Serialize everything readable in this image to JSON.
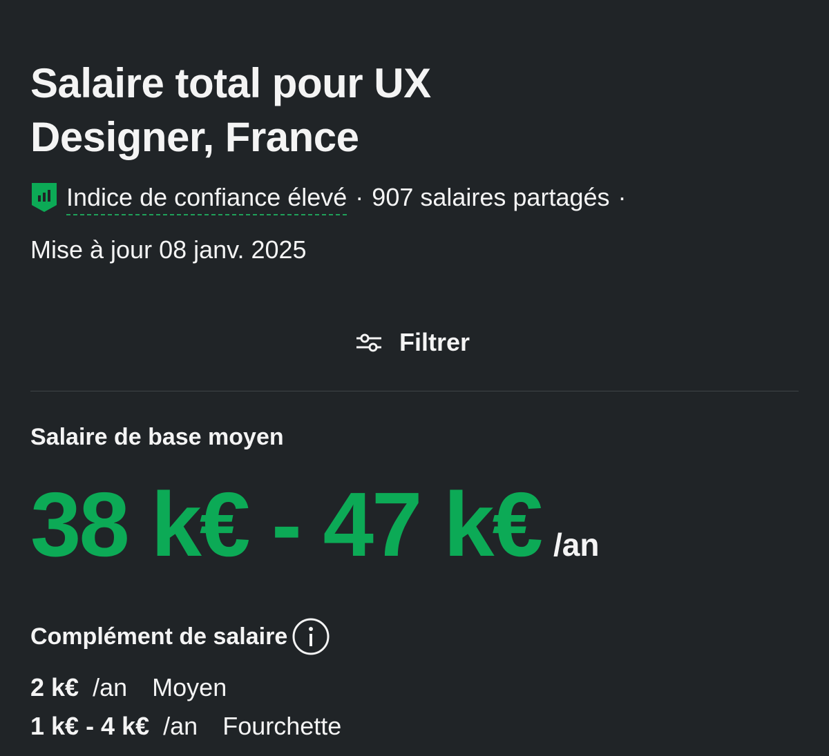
{
  "header": {
    "title": "Salaire total pour UX Designer, France",
    "confidence": "Indice de confiance élevé",
    "separator": "·",
    "shared": "907 salaires partagés",
    "updated": "Mise à jour 08 janv. 2025"
  },
  "filter": {
    "label": "Filtrer",
    "icon": "sliders-icon"
  },
  "base_salary": {
    "label": "Salaire de base moyen",
    "range": "38 k€ - 47 k€",
    "unit": "/an"
  },
  "supplement": {
    "label": "Complément de salaire",
    "info_icon": "info-icon",
    "rows": [
      {
        "value": "2 k€",
        "unit": "/an",
        "label": "Moyen"
      },
      {
        "value": "1 k€ - 4 k€",
        "unit": "/an",
        "label": "Fourchette"
      }
    ]
  },
  "colors": {
    "background": "#202427",
    "accent_green": "#0caa56",
    "text": "#f4f4f4"
  }
}
